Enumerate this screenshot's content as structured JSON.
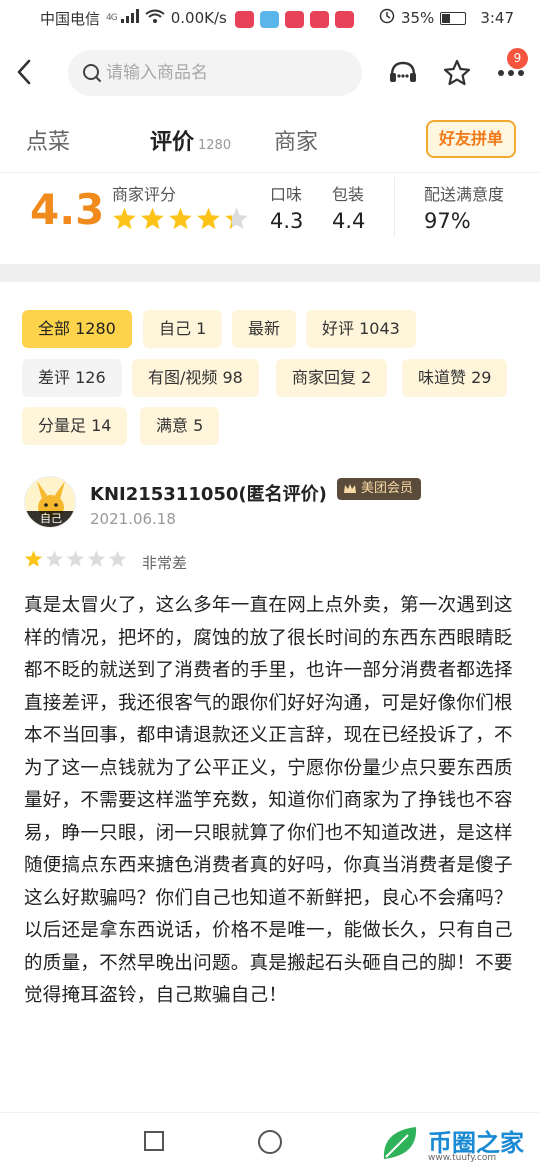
{
  "status_bar": {
    "carrier": "中国电信",
    "network": "4G",
    "speed": "0.00K/s",
    "battery": "35%",
    "battery_level": 0.35,
    "time": "3:47"
  },
  "search": {
    "placeholder": "请输入商品名"
  },
  "nav": {
    "badge_count": "9"
  },
  "tabs": [
    {
      "label": "点菜"
    },
    {
      "label": "评价",
      "count": "1280"
    },
    {
      "label": "商家"
    }
  ],
  "group_button": "好友拼单",
  "rating": {
    "score": "4.3",
    "score_label": "商家评分",
    "score_stars": 4.3,
    "taste_label": "口味",
    "taste_value": "4.3",
    "pack_label": "包装",
    "pack_value": "4.4",
    "delivery_label": "配送满意度",
    "delivery_value": "97%"
  },
  "filters": [
    {
      "label": "全部 1280",
      "active": true
    },
    {
      "label": "自己 1"
    },
    {
      "label": "最新"
    },
    {
      "label": "好评 1043"
    },
    {
      "label": "差评 126",
      "grey": true
    },
    {
      "label": "有图/视频 98"
    },
    {
      "label": "商家回复 2"
    },
    {
      "label": "味道赞 29"
    },
    {
      "label": "分量足 14"
    },
    {
      "label": "满意 5"
    }
  ],
  "review": {
    "avatar_tag": "自己",
    "username": "KNI215311050(匿名评价)",
    "member_badge": "美团会员",
    "date": "2021.06.18",
    "stars": 1,
    "star_label": "非常差",
    "text": "真是太冒火了，这么多年一直在网上点外卖，第一次遇到这样的情况，把坏的，腐蚀的放了很长时间的东西东西眼睛眨都不眨的就送到了消费者的手里，也许一部分消费者都选择直接差评，我还很客气的跟你们好好沟通，可是好像你们根本不当回事，都申请退款还义正言辞，现在已经投诉了，不为了这一点钱就为了公平正义，宁愿你份量少点只要东西质量好，不需要这样滥竽充数，知道你们商家为了挣钱也不容易，睁一只眼，闭一只眼就算了你们也不知道改进，是这样随便搞点东西来搪色消费者真的好吗，你真当消费者是傻子这么好欺骗吗？你们自己也知道不新鲜把，良心不会痛吗？以后还是拿东西说话，价格不是唯一，能做长久，只有自己的质量，不然早晚出问题。真是搬起石头砸自己的脚！不要觉得掩耳盗铃，自己欺骗自己！"
  },
  "watermark": {
    "name": "币圈之家",
    "url": "www.tuufy.com"
  },
  "colors": {
    "accent": "#f08a1c",
    "star": "#fcc419",
    "chip_active": "#fcd34b",
    "chip": "#fff5db"
  }
}
